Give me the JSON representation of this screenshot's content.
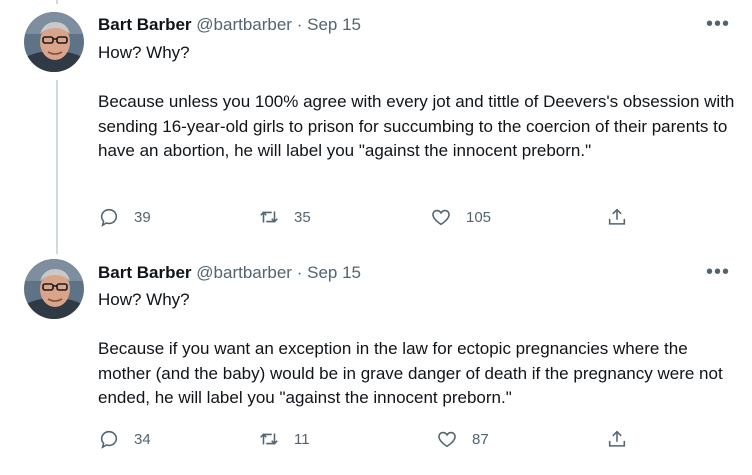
{
  "tweets": [
    {
      "name": "Bart Barber",
      "handle": "@bartbarber",
      "separator": "·",
      "date": "Sep 15",
      "more": "•••",
      "text": "How? Why?\n\nBecause unless you 100% agree with every jot and tittle of Deevers's obsession with sending 16-year-old girls to prison for succumbing to the coercion of their parents to have an abortion, he will label you \"against the innocent preborn.\"",
      "replies": "39",
      "retweets": "35",
      "likes": "105",
      "icons": {
        "reply": "reply-icon",
        "retweet": "retweet-icon",
        "like": "heart-icon",
        "share": "share-icon"
      }
    },
    {
      "name": "Bart Barber",
      "handle": "@bartbarber",
      "separator": "·",
      "date": "Sep 15",
      "more": "•••",
      "text": "How? Why?\n\nBecause if you want an exception in the law for ectopic pregnancies where the mother (and the baby) would be in grave danger of death if the pregnancy were not ended, he will label you \"against the innocent preborn.\"",
      "replies": "34",
      "retweets": "11",
      "likes": "87",
      "icons": {
        "reply": "reply-icon",
        "retweet": "retweet-icon",
        "like": "heart-icon",
        "share": "share-icon"
      }
    }
  ],
  "colors": {
    "text": "#0f1419",
    "secondary": "#536471",
    "thread_line": "#cfd9de"
  }
}
